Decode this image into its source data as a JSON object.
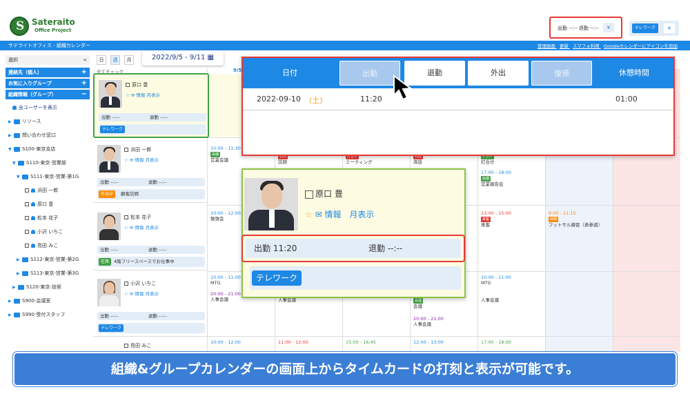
{
  "logo": {
    "name": "Sateraito",
    "sub": "Office Project"
  },
  "top_status": {
    "text": "出勤 --:--   退勤 --:--",
    "dropdown": "¥"
  },
  "telework": {
    "button": "テレワーク",
    "dropdown": "¥"
  },
  "app_bar": {
    "title": "サテライトオフィス - 組織カレンダー",
    "links": [
      "管理画面",
      "更新",
      "スマフォ利用",
      "Googleカレンダーにアイコンを追加"
    ]
  },
  "sidebar": {
    "select": "選択",
    "collapse": "<",
    "sections": [
      "連絡先（個人）",
      "お気に入りグループ",
      "組織情報（グループ）"
    ],
    "all_users": "全ユーザーを表示",
    "tree": [
      "リソース",
      "問い合わせ窓口",
      "S100-東京支店",
      "S110-東京-営業部",
      "S111-東京-営業-第1G",
      "浜田 一郎",
      "原口 豊",
      "松本 花子",
      "小沢 いちこ",
      "島田 みこ",
      "S112-東京-営業-第2G",
      "S113-東京-営業-第3G",
      "S120-東京-技術",
      "S900-会議室",
      "S990-受付スタッフ"
    ]
  },
  "view_tabs": [
    "日",
    "週",
    "月"
  ],
  "date_range": "2022/9/5 - 9/11 ▦",
  "all_check": "全てチェック",
  "col_date": "9/5",
  "users": [
    {
      "name": "原口 豊",
      "links": "☆ ✉ 情報  月表示",
      "in": "出勤 --:--",
      "out": "退勤 --:--",
      "badge": "テレワーク",
      "badge_text": ""
    },
    {
      "name": "浜田 一郎",
      "links": "☆ ✉ 情報  月表示",
      "in": "出勤 --:--",
      "out": "退勤 --:--",
      "badge": "外出中",
      "badge_text": "顧客訪問"
    },
    {
      "name": "松本 花子",
      "links": "☆ ✉ 情報  月表示",
      "in": "出勤 --:--",
      "out": "退勤 --:--",
      "badge": "在席",
      "badge_text": "4階フリースペースでお仕事中"
    },
    {
      "name": "小沢 いちこ",
      "links": "☆ ✉ 情報  月表示",
      "in": "出勤 --:--",
      "out": "退勤 --:--",
      "badge": "テレワーク",
      "badge_text": ""
    },
    {
      "name": "島田 みこ",
      "links": "☆ ✉ 情報  月表示",
      "in": "",
      "out": "",
      "badge": "",
      "badge_text": ""
    }
  ],
  "events": {
    "e1": {
      "time": "10:00 - 11:30",
      "tag": "会議",
      "title": "営業会議"
    },
    "e2": {
      "time": "",
      "tag": "訪問",
      "title": "訪問"
    },
    "e3": {
      "time": "",
      "tag": "打合せ",
      "title": "ミーティング"
    },
    "e4": {
      "time": "",
      "tag": "商談",
      "title": "商談"
    },
    "e5": {
      "time": "",
      "tag": "打合せ",
      "title": "打合せ"
    },
    "e6": {
      "time": "17:00 - 18:00",
      "tag": "会議",
      "title": "営業報告会"
    },
    "e7": {
      "time": "10:00 - 12:00",
      "tag": "",
      "title": "勉強会"
    },
    "e8": {
      "time": "13:00 - 15:00",
      "tag": "来客",
      "title": "来客"
    },
    "e9": {
      "time": "9:00 - 11:15",
      "tag": "休暇",
      "title": "フットサル練習（表参道）"
    },
    "e10": {
      "time": "10:00 - 11:00",
      "tag": "",
      "title": "MTG"
    },
    "e11": {
      "time": "20:00 - 21:00",
      "tag": "",
      "title": "人事会議"
    },
    "e12": {
      "time": "",
      "tag": "",
      "title": "人事会議"
    },
    "e13": {
      "time": "10:00 - 11:00",
      "tag": "",
      "title": "MTG"
    },
    "e14": {
      "time": "",
      "tag": "",
      "title": "人事会議"
    },
    "e15": {
      "time": "",
      "tag": "会議",
      "title": "会議"
    },
    "e16": {
      "time": "20:00 - 21:00",
      "tag": "",
      "title": "人事会議"
    },
    "e17": {
      "time": "10:00 - 12:00",
      "tag": "",
      "title": ""
    },
    "e18": {
      "time": "11:00 - 12:00",
      "tag": "",
      "title": ""
    },
    "e19": {
      "time": "15:00 - 16:45",
      "tag": "",
      "title": ""
    },
    "e20": {
      "time": "12:00 - 13:00",
      "tag": "",
      "title": ""
    },
    "e21": {
      "time": "17:00 - 18:00",
      "tag": "",
      "title": ""
    }
  },
  "timecard": {
    "headers": [
      "日付",
      "出勤",
      "退勤",
      "外出",
      "復帰",
      "休憩時間"
    ],
    "row": {
      "date": "2022-09-10",
      "dow": "土",
      "in": "11:20",
      "break": "01:00"
    }
  },
  "zoom_card": {
    "name": "原口 豊",
    "info": "情報",
    "month": "月表示",
    "in": "出勤 11:20",
    "out": "退勤 --:--",
    "badge": "テレワーク"
  },
  "banner": "組織&グループカレンダーの画面上からタイムカードの打刻と表示が可能です。",
  "colors": {
    "accent": "#1e88e5",
    "highlight": "#e53935",
    "green_frame": "#8bc34a",
    "banner": "#3b7ed6"
  }
}
